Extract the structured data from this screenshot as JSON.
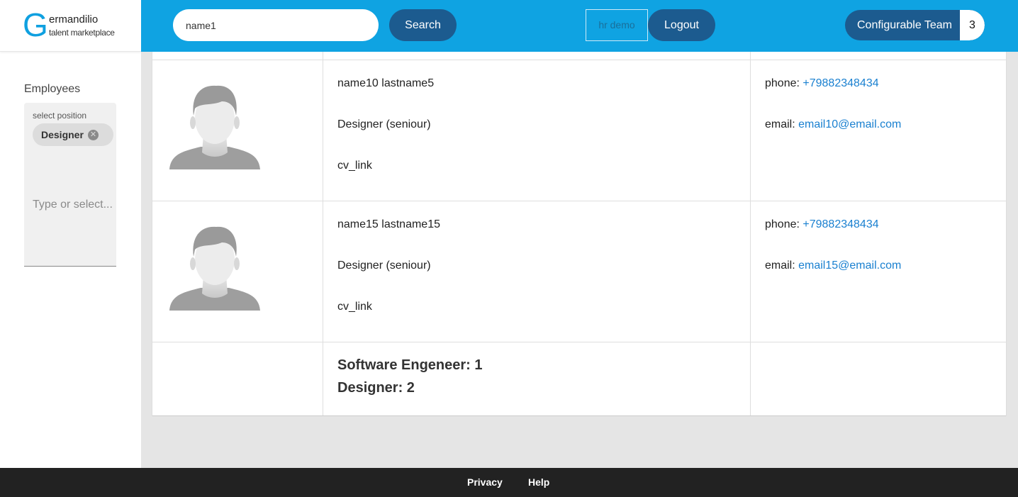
{
  "logo": {
    "letter": "G",
    "brand": "ermandilio",
    "tagline": "talent marketplace"
  },
  "sidebar": {
    "title": "Employees",
    "filter": {
      "label": "select position",
      "chip": "Designer",
      "placeholder": "Type or select..."
    }
  },
  "header": {
    "search_value": "name1",
    "search_label": "Search",
    "hr_placeholder": "hr demo",
    "logout_label": "Logout",
    "team_label": "Configurable Team",
    "team_count": "3"
  },
  "employees": [
    {
      "name": "name10 lastname5",
      "position": "Designer (seniour)",
      "cv": "cv_link",
      "phone_label": "phone: ",
      "phone": "+79882348434",
      "email_label": "email: ",
      "email": "email10@email.com"
    },
    {
      "name": "name15 lastname15",
      "position": "Designer (seniour)",
      "cv": "cv_link",
      "phone_label": "phone: ",
      "phone": "+79882348434",
      "email_label": "email: ",
      "email": "email15@email.com"
    }
  ],
  "summary": [
    "Software Engeneer: 1",
    "Designer: 2"
  ],
  "footer": {
    "privacy": "Privacy",
    "help": "Help"
  },
  "colors": {
    "header": "#0fa3e2",
    "button": "#1c5b8f",
    "link": "#1a80d0",
    "footer": "#222222"
  }
}
